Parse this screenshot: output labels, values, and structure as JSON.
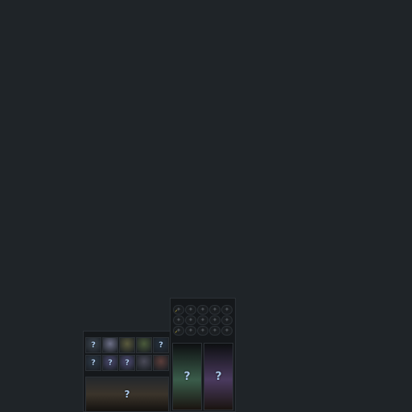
{
  "app": {
    "background": "#1f2428"
  },
  "upper_panel": {
    "title": "",
    "rows": [
      [
        {
          "icon": "star-icon",
          "checked": true
        },
        {
          "icon": "star-icon",
          "checked": false
        },
        {
          "icon": "star-icon",
          "checked": false
        },
        {
          "icon": "star-icon",
          "checked": false
        },
        {
          "icon": "star-icon",
          "checked": false
        }
      ],
      [
        {
          "icon": "star-icon",
          "checked": false
        },
        {
          "icon": "star-icon",
          "checked": false
        },
        {
          "icon": "star-icon",
          "checked": false
        },
        {
          "icon": "star-icon",
          "checked": false
        },
        {
          "icon": "star-icon",
          "checked": false
        }
      ],
      [
        {
          "icon": "star-icon",
          "checked": true
        },
        {
          "icon": "star-icon",
          "checked": false
        },
        {
          "icon": "star-icon",
          "checked": false
        },
        {
          "icon": "star-icon",
          "checked": false
        },
        {
          "icon": "star-icon",
          "checked": false
        }
      ]
    ],
    "sub_title": "",
    "portraits": [
      {
        "glyph": "?",
        "color": "#3a5c4a"
      },
      {
        "glyph": "?",
        "color": "#4a3a5e"
      }
    ]
  },
  "left_panel": {
    "title": "",
    "row1": [
      {
        "glyph": "?",
        "color": "#3d4650"
      },
      {
        "glyph": "",
        "color": "#6c6f86"
      },
      {
        "glyph": "",
        "color": "#5a5a3c"
      },
      {
        "glyph": "",
        "color": "#4a5a3a"
      },
      {
        "glyph": "?",
        "color": "#26323f"
      }
    ],
    "row2": [
      {
        "glyph": "?",
        "color": "#2e3a48"
      },
      {
        "glyph": "?",
        "color": "#4d4b72"
      },
      {
        "glyph": "?",
        "color": "#514e78"
      },
      {
        "glyph": "",
        "color": "#4a4a58"
      },
      {
        "glyph": "",
        "color": "#5a3d3a"
      }
    ],
    "sub_title": "",
    "banner": [
      {
        "glyph": "?",
        "color": "#3b342b"
      }
    ]
  },
  "glyphs": {
    "star": "✦",
    "check": "✓"
  }
}
